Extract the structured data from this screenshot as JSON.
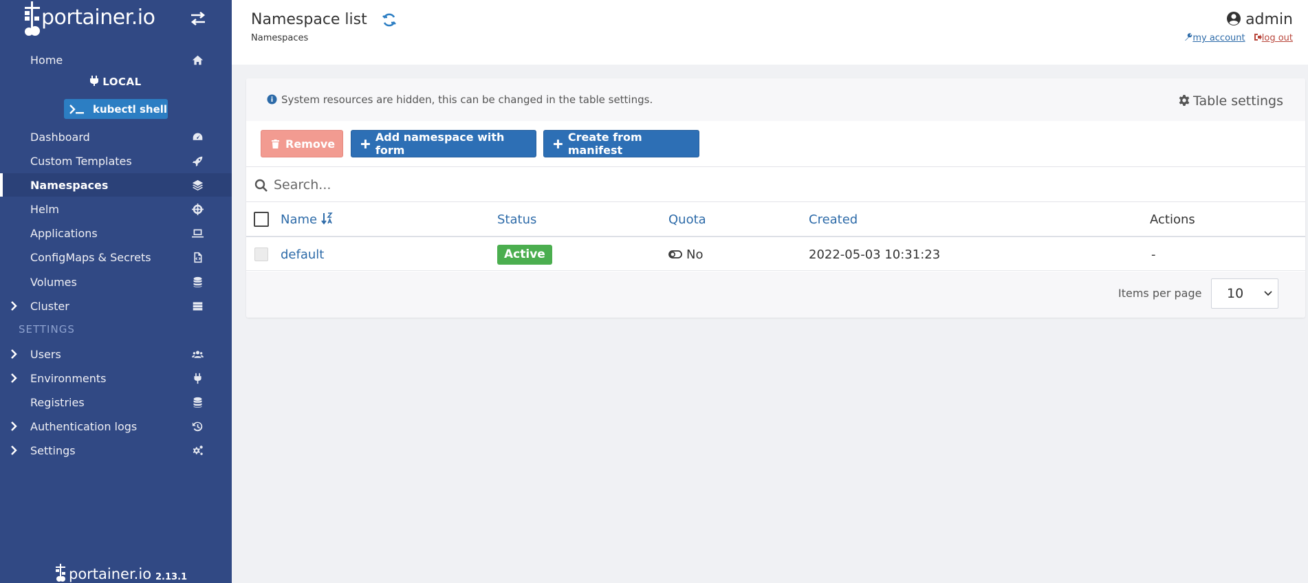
{
  "sidebar": {
    "logo_text": "portainer.io",
    "items_top": [
      {
        "label": "Home",
        "icon": "home-icon"
      }
    ],
    "environment": {
      "name": "LOCAL",
      "kubectl_label": "kubectl shell"
    },
    "items_env": [
      {
        "label": "Dashboard",
        "icon": "dashboard-icon"
      },
      {
        "label": "Custom Templates",
        "icon": "rocket-icon"
      },
      {
        "label": "Namespaces",
        "icon": "layers-icon",
        "active": true
      },
      {
        "label": "Helm",
        "icon": "helm-icon"
      },
      {
        "label": "Applications",
        "icon": "laptop-code-icon"
      },
      {
        "label": "ConfigMaps & Secrets",
        "icon": "file-code-icon"
      },
      {
        "label": "Volumes",
        "icon": "database-icon"
      },
      {
        "label": "Cluster",
        "icon": "server-icon",
        "expandable": true
      }
    ],
    "settings_heading": "SETTINGS",
    "items_settings": [
      {
        "label": "Users",
        "icon": "users-icon",
        "expandable": true
      },
      {
        "label": "Environments",
        "icon": "plug-icon",
        "expandable": true
      },
      {
        "label": "Registries",
        "icon": "database-icon"
      },
      {
        "label": "Authentication logs",
        "icon": "history-icon",
        "expandable": true
      },
      {
        "label": "Settings",
        "icon": "cogs-icon",
        "expandable": true
      }
    ],
    "footer_logo": "portainer.io",
    "version": "2.13.1"
  },
  "header": {
    "title": "Namespace list",
    "breadcrumb": "Namespaces",
    "user": "admin",
    "my_account": "my account",
    "log_out": "log out"
  },
  "panel": {
    "info": "System resources are hidden, this can be changed in the table settings.",
    "table_settings": "Table settings",
    "buttons": {
      "remove": "Remove",
      "add_form": "Add namespace with form",
      "manifest": "Create from manifest"
    },
    "search_placeholder": "Search...",
    "columns": {
      "name": "Name",
      "status": "Status",
      "quota": "Quota",
      "created": "Created",
      "actions": "Actions"
    },
    "rows": [
      {
        "name": "default",
        "status": "Active",
        "quota": "No",
        "created": "2022-05-03 10:31:23",
        "actions": "-"
      }
    ],
    "items_per_page_label": "Items per page",
    "items_per_page_value": "10"
  },
  "colors": {
    "sidebar_bg": "#314984",
    "primary": "#2d6fb5",
    "danger_light": "#f29b91",
    "success": "#4bae4f"
  }
}
